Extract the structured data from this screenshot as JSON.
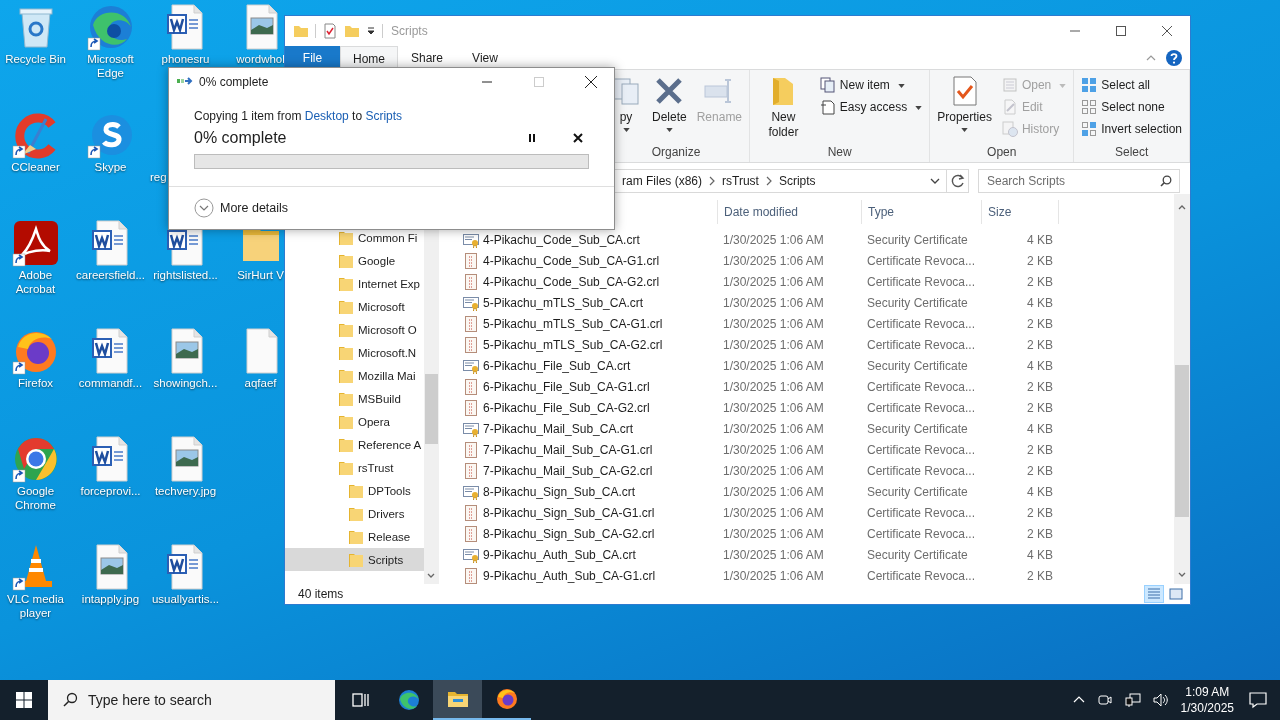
{
  "desktop": {
    "rows": [
      [
        {
          "label": "Recycle Bin",
          "kind": "recycle",
          "shortcut": false
        },
        {
          "label": "Microsoft Edge",
          "kind": "edge",
          "shortcut": true
        },
        {
          "label": "phonesru",
          "kind": "word",
          "shortcut": false
        },
        {
          "label": "wordwhol",
          "kind": "image",
          "shortcut": false
        }
      ],
      [
        {
          "label": "CCleaner",
          "kind": "ccleaner",
          "shortcut": true
        },
        {
          "label": "Skype",
          "kind": "skype",
          "shortcut": true
        },
        {
          "label": "reg",
          "kind": "covered"
        }
      ],
      [
        {
          "label": "Adobe Acrobat",
          "kind": "acrobat",
          "shortcut": true
        },
        {
          "label": "careersfield...",
          "kind": "word",
          "shortcut": false
        },
        {
          "label": "rightslisted...",
          "kind": "word",
          "shortcut": false
        },
        {
          "label": "SirHurt V",
          "kind": "folder",
          "shortcut": false
        }
      ],
      [
        {
          "label": "Firefox",
          "kind": "firefox",
          "shortcut": true
        },
        {
          "label": "commandf...",
          "kind": "word",
          "shortcut": false
        },
        {
          "label": "showingch...",
          "kind": "image",
          "shortcut": false
        },
        {
          "label": "aqfaef",
          "kind": "blank",
          "shortcut": false
        }
      ],
      [
        {
          "label": "Google Chrome",
          "kind": "chrome",
          "shortcut": true
        },
        {
          "label": "forceprovi...",
          "kind": "word",
          "shortcut": false
        },
        {
          "label": "techvery.jpg",
          "kind": "image",
          "shortcut": false
        }
      ],
      [
        {
          "label": "VLC media player",
          "kind": "vlc",
          "shortcut": true
        },
        {
          "label": "intapply.jpg",
          "kind": "image",
          "shortcut": false
        },
        {
          "label": "usuallyartis...",
          "kind": "word",
          "shortcut": false
        }
      ]
    ]
  },
  "explorer": {
    "title": "Scripts",
    "tabs": [
      {
        "label": "File",
        "kind": "file",
        "selected": false
      },
      {
        "label": "Home",
        "kind": "tab",
        "selected": true
      },
      {
        "label": "Share",
        "kind": "tab",
        "selected": false
      },
      {
        "label": "View",
        "kind": "tab",
        "selected": false
      }
    ],
    "ribbon": [
      {
        "label": "Organize",
        "items": [
          {
            "label": "py",
            "kind": "copy",
            "disabled": false,
            "dropdown": true
          },
          {
            "label": "Delete",
            "kind": "delete",
            "disabled": false,
            "dropdown": true
          },
          {
            "label": "Rename",
            "kind": "rename",
            "disabled": true,
            "dropdown": false
          }
        ]
      },
      {
        "label": "New",
        "items": [
          {
            "label": "New folder",
            "kind": "new-folder",
            "disabled": false,
            "dropdown": false
          },
          {
            "label": "New item",
            "kind": "new-item",
            "disabled": false,
            "dropdown": true
          },
          {
            "label": "Easy access",
            "kind": "easy-access",
            "disabled": false,
            "dropdown": true
          }
        ]
      },
      {
        "label": "Open",
        "items": [
          {
            "label": "Properties",
            "kind": "properties",
            "disabled": false,
            "dropdown": true
          },
          {
            "label": "Open",
            "kind": "open",
            "disabled": true,
            "dropdown": true
          },
          {
            "label": "Edit",
            "kind": "edit",
            "disabled": true,
            "dropdown": false
          },
          {
            "label": "History",
            "kind": "history",
            "disabled": true,
            "dropdown": false
          }
        ]
      },
      {
        "label": "Select",
        "items": [
          {
            "label": "Select all",
            "kind": "select-all",
            "disabled": false,
            "dropdown": false
          },
          {
            "label": "Select none",
            "kind": "select-none",
            "disabled": false,
            "dropdown": false
          },
          {
            "label": "Invert selection",
            "kind": "invert-selection",
            "disabled": false,
            "dropdown": false
          }
        ]
      }
    ],
    "breadcrumbs": [
      "ram Files (x86)",
      "rsTrust",
      "Scripts"
    ],
    "search": {
      "placeholder": "Search Scripts"
    },
    "tree": [
      {
        "label": "Common Fi",
        "selected": false
      },
      {
        "label": "Google",
        "selected": false
      },
      {
        "label": "Internet Exp",
        "selected": false
      },
      {
        "label": "Microsoft",
        "selected": false
      },
      {
        "label": "Microsoft O",
        "selected": false
      },
      {
        "label": "Microsoft.N",
        "selected": false
      },
      {
        "label": "Mozilla Mai",
        "selected": false
      },
      {
        "label": "MSBuild",
        "selected": false
      },
      {
        "label": "Opera",
        "selected": false
      },
      {
        "label": "Reference A",
        "selected": false
      },
      {
        "label": "rsTrust",
        "selected": false,
        "children": [
          {
            "label": "DPTools",
            "selected": false
          },
          {
            "label": "Drivers",
            "selected": false
          },
          {
            "label": "Release",
            "selected": false
          },
          {
            "label": "Scripts",
            "selected": true
          }
        ]
      }
    ],
    "columns": [
      "Date modified",
      "Type",
      "Size"
    ],
    "files": [
      {
        "name": "4-Pikachu_Code_Sub_CA.crt",
        "kind": "certificate",
        "date": "1/30/2025 1:06 AM",
        "type": "Security Certificate",
        "size": "4 KB"
      },
      {
        "name": "4-Pikachu_Code_Sub_CA-G1.crl",
        "kind": "revocation-list",
        "date": "1/30/2025 1:06 AM",
        "type": "Certificate Revoca...",
        "size": "2 KB"
      },
      {
        "name": "4-Pikachu_Code_Sub_CA-G2.crl",
        "kind": "revocation-list",
        "date": "1/30/2025 1:06 AM",
        "type": "Certificate Revoca...",
        "size": "2 KB"
      },
      {
        "name": "5-Pikachu_mTLS_Sub_CA.crt",
        "kind": "certificate",
        "date": "1/30/2025 1:06 AM",
        "type": "Security Certificate",
        "size": "4 KB"
      },
      {
        "name": "5-Pikachu_mTLS_Sub_CA-G1.crl",
        "kind": "revocation-list",
        "date": "1/30/2025 1:06 AM",
        "type": "Certificate Revoca...",
        "size": "2 KB"
      },
      {
        "name": "5-Pikachu_mTLS_Sub_CA-G2.crl",
        "kind": "revocation-list",
        "date": "1/30/2025 1:06 AM",
        "type": "Certificate Revoca...",
        "size": "2 KB"
      },
      {
        "name": "6-Pikachu_File_Sub_CA.crt",
        "kind": "certificate",
        "date": "1/30/2025 1:06 AM",
        "type": "Security Certificate",
        "size": "4 KB"
      },
      {
        "name": "6-Pikachu_File_Sub_CA-G1.crl",
        "kind": "revocation-list",
        "date": "1/30/2025 1:06 AM",
        "type": "Certificate Revoca...",
        "size": "2 KB"
      },
      {
        "name": "6-Pikachu_File_Sub_CA-G2.crl",
        "kind": "revocation-list",
        "date": "1/30/2025 1:06 AM",
        "type": "Certificate Revoca...",
        "size": "2 KB"
      },
      {
        "name": "7-Pikachu_Mail_Sub_CA.crt",
        "kind": "certificate",
        "date": "1/30/2025 1:06 AM",
        "type": "Security Certificate",
        "size": "4 KB"
      },
      {
        "name": "7-Pikachu_Mail_Sub_CA-G1.crl",
        "kind": "revocation-list",
        "date": "1/30/2025 1:06 AM",
        "type": "Certificate Revoca...",
        "size": "2 KB"
      },
      {
        "name": "7-Pikachu_Mail_Sub_CA-G2.crl",
        "kind": "revocation-list",
        "date": "1/30/2025 1:06 AM",
        "type": "Certificate Revoca...",
        "size": "2 KB"
      },
      {
        "name": "8-Pikachu_Sign_Sub_CA.crt",
        "kind": "certificate",
        "date": "1/30/2025 1:06 AM",
        "type": "Security Certificate",
        "size": "4 KB"
      },
      {
        "name": "8-Pikachu_Sign_Sub_CA-G1.crl",
        "kind": "revocation-list",
        "date": "1/30/2025 1:06 AM",
        "type": "Certificate Revoca...",
        "size": "2 KB"
      },
      {
        "name": "8-Pikachu_Sign_Sub_CA-G2.crl",
        "kind": "revocation-list",
        "date": "1/30/2025 1:06 AM",
        "type": "Certificate Revoca...",
        "size": "2 KB"
      },
      {
        "name": "9-Pikachu_Auth_Sub_CA.crt",
        "kind": "certificate",
        "date": "1/30/2025 1:06 AM",
        "type": "Security Certificate",
        "size": "4 KB"
      },
      {
        "name": "9-Pikachu_Auth_Sub_CA-G1.crl",
        "kind": "revocation-list",
        "date": "1/30/2025 1:06 AM",
        "type": "Certificate Revoca...",
        "size": "2 KB"
      }
    ],
    "status": "40 items",
    "views": [
      {
        "kind": "details",
        "selected": true
      },
      {
        "kind": "large-icons",
        "selected": false
      }
    ]
  },
  "copy_dialog": {
    "title": "0% complete",
    "message": {
      "before": "Copying 1 item from ",
      "source": "Desktop",
      "middle": " to ",
      "destination": "Scripts"
    },
    "heading": "0% complete",
    "progress": {
      "level": 0
    },
    "details": "More details",
    "maximize_disabled": true
  },
  "taskbar": {
    "search": {
      "placeholder": "Type here to search"
    },
    "apps": [
      {
        "kind": "task-view",
        "active": false,
        "running": false
      },
      {
        "kind": "edge",
        "active": false,
        "running": false
      },
      {
        "kind": "explorer",
        "active": true,
        "running": true
      },
      {
        "kind": "firefox",
        "active": false,
        "running": true
      }
    ],
    "time": "1:09 AM",
    "date": "1/30/2025"
  }
}
